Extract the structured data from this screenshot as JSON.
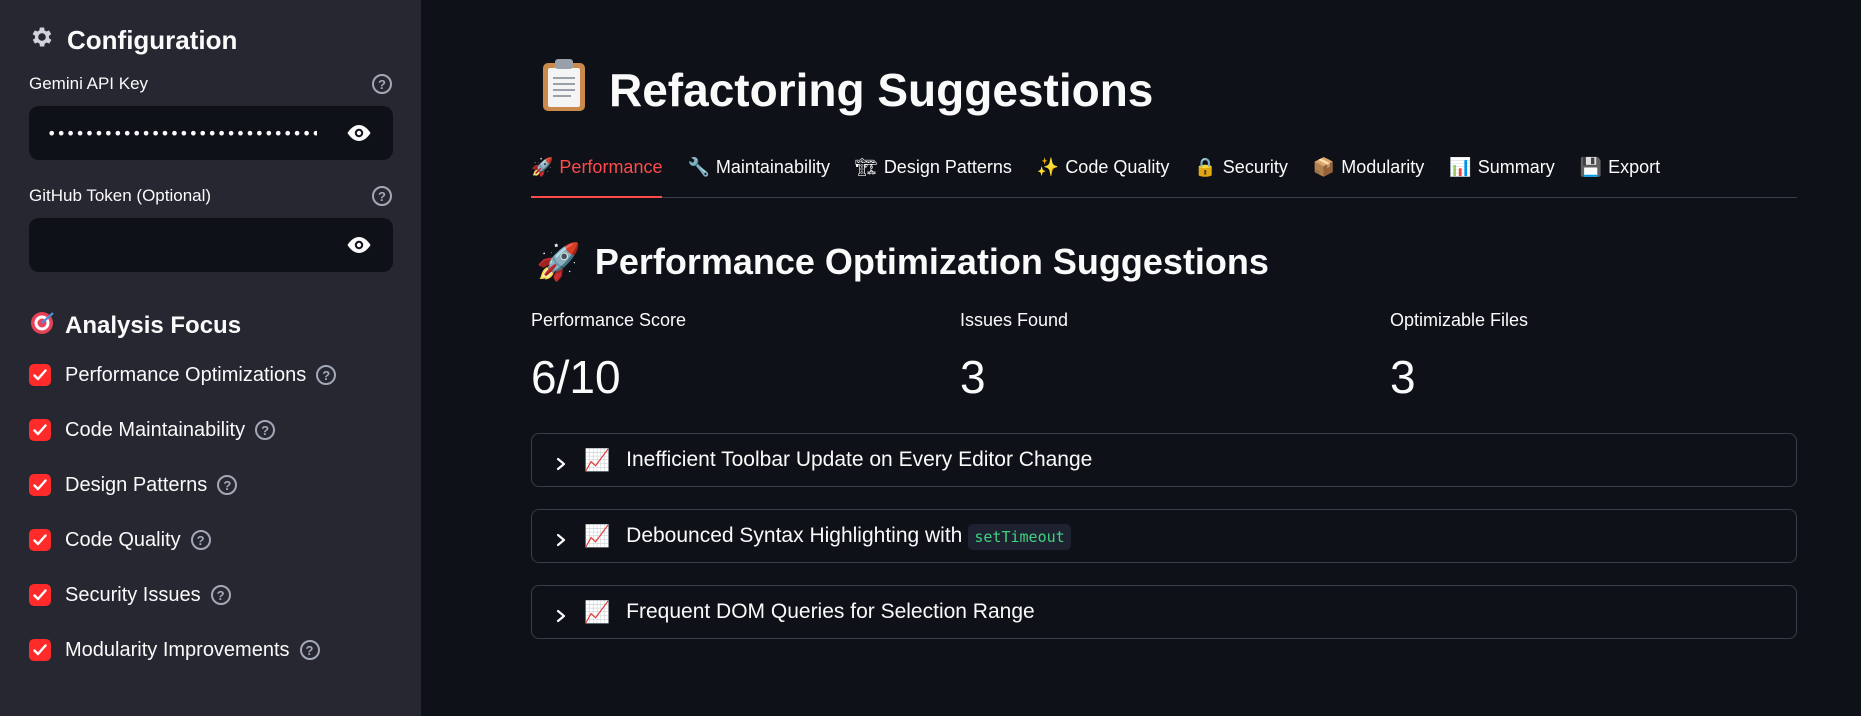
{
  "sidebar": {
    "header_icon": "gear-icon",
    "header": "Configuration",
    "api_key": {
      "label": "Gemini API Key",
      "value": "•••••••••••••••••••••••••••••••••••••••"
    },
    "github_token": {
      "label": "GitHub Token (Optional)",
      "value": ""
    },
    "focus_icon": "target-icon",
    "focus_title": "Analysis Focus",
    "checkboxes": [
      {
        "label": "Performance Optimizations",
        "checked": true
      },
      {
        "label": "Code Maintainability",
        "checked": true
      },
      {
        "label": "Design Patterns",
        "checked": true
      },
      {
        "label": "Code Quality",
        "checked": true
      },
      {
        "label": "Security Issues",
        "checked": true
      },
      {
        "label": "Modularity Improvements",
        "checked": true
      }
    ]
  },
  "main": {
    "title_icon": "clipboard-icon",
    "title": "Refactoring Suggestions",
    "tabs": [
      {
        "icon": "🚀",
        "label": "Performance",
        "active": true
      },
      {
        "icon": "🔧",
        "label": "Maintainability",
        "active": false
      },
      {
        "icon": "🏗",
        "label": "Design Patterns",
        "active": false
      },
      {
        "icon": "✨",
        "label": "Code Quality",
        "active": false
      },
      {
        "icon": "🔒",
        "label": "Security",
        "active": false
      },
      {
        "icon": "📦",
        "label": "Modularity",
        "active": false
      },
      {
        "icon": "📊",
        "label": "Summary",
        "active": false
      },
      {
        "icon": "💾",
        "label": "Export",
        "active": false
      }
    ],
    "section_icon": "🚀",
    "section_title": "Performance Optimization Suggestions",
    "metrics": [
      {
        "label": "Performance Score",
        "value": "6/10"
      },
      {
        "label": "Issues Found",
        "value": "3"
      },
      {
        "label": "Optimizable Files",
        "value": "3"
      }
    ],
    "expanders": [
      {
        "icon": "📈",
        "title": "Inefficient Toolbar Update on Every Editor Change",
        "code": ""
      },
      {
        "icon": "📈",
        "title": "Debounced Syntax Highlighting with",
        "code": "setTimeout"
      },
      {
        "icon": "📈",
        "title": "Frequent DOM Queries for Selection Range",
        "code": ""
      }
    ]
  },
  "colors": {
    "accent": "#ff4b4b",
    "sidebar_bg": "#262730",
    "main_bg": "#0e1117",
    "code_text": "#3ed27f"
  }
}
